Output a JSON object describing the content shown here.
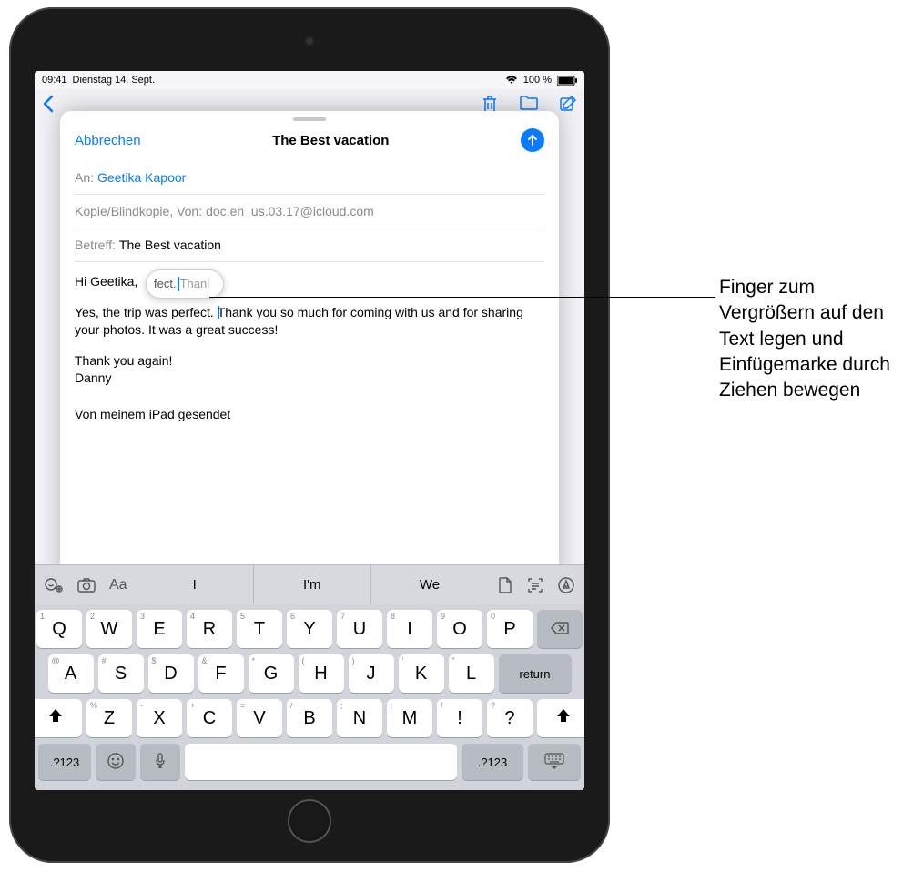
{
  "status": {
    "time": "09:41",
    "date": "Dienstag 14. Sept.",
    "battery_pct": "100 %"
  },
  "mail_bg": {
    "icons": {
      "back": "chevron-left",
      "trash": "trash",
      "folder": "folder",
      "compose": "compose"
    }
  },
  "compose": {
    "cancel": "Abbrechen",
    "title": "The Best vacation",
    "to_label": "An:",
    "to_value": "Geetika Kapoor",
    "cc_label": "Kopie/Blindkopie, Von:",
    "cc_value": "doc.en_us.03.17@icloud.com",
    "subject_label": "Betreff:",
    "subject_value": "The Best vacation",
    "body": {
      "greeting": "Hi Geetika,",
      "p1_before": "Yes, the trip was perfect. ",
      "p1_after": "Thank you so much for coming with us and for sharing your photos. It was a great success!",
      "p2": "Thank you again!",
      "p3": "Danny",
      "sig": "Von meinem iPad gesendet"
    },
    "magnifier": {
      "left": "fect.",
      "right": "Thanl"
    }
  },
  "quicktype": {
    "left_icons": [
      "emoji-search-icon",
      "camera-icon",
      "format-icon"
    ],
    "suggestions": [
      "I",
      "I'm",
      "We"
    ],
    "right_icons": [
      "document-icon",
      "scan-icon",
      "markup-icon"
    ]
  },
  "keyboard": {
    "row1": [
      {
        "sec": "1",
        "main": "Q"
      },
      {
        "sec": "2",
        "main": "W"
      },
      {
        "sec": "3",
        "main": "E"
      },
      {
        "sec": "4",
        "main": "R"
      },
      {
        "sec": "5",
        "main": "T"
      },
      {
        "sec": "6",
        "main": "Y"
      },
      {
        "sec": "7",
        "main": "U"
      },
      {
        "sec": "8",
        "main": "I"
      },
      {
        "sec": "9",
        "main": "O"
      },
      {
        "sec": "0",
        "main": "P"
      }
    ],
    "row2": [
      {
        "sec": "@",
        "main": "A"
      },
      {
        "sec": "#",
        "main": "S"
      },
      {
        "sec": "$",
        "main": "D"
      },
      {
        "sec": "&",
        "main": "F"
      },
      {
        "sec": "*",
        "main": "G"
      },
      {
        "sec": "(",
        "main": "H"
      },
      {
        "sec": ")",
        "main": "J"
      },
      {
        "sec": "'",
        "main": "K"
      },
      {
        "sec": "\"",
        "main": "L"
      }
    ],
    "return": "return",
    "row3": [
      {
        "sec": "%",
        "main": "Z"
      },
      {
        "sec": "-",
        "main": "X"
      },
      {
        "sec": "+",
        "main": "C"
      },
      {
        "sec": "=",
        "main": "V"
      },
      {
        "sec": "/",
        "main": "B"
      },
      {
        "sec": ";",
        "main": "N"
      },
      {
        "sec": ":",
        "main": "M"
      },
      {
        "sec": "!",
        "main": "!"
      },
      {
        "sec": "?",
        "main": "?"
      }
    ],
    "numkey": ".?123"
  },
  "callout": "Finger zum Vergrößern auf den Text legen und Einfügemarke durch Ziehen bewegen"
}
